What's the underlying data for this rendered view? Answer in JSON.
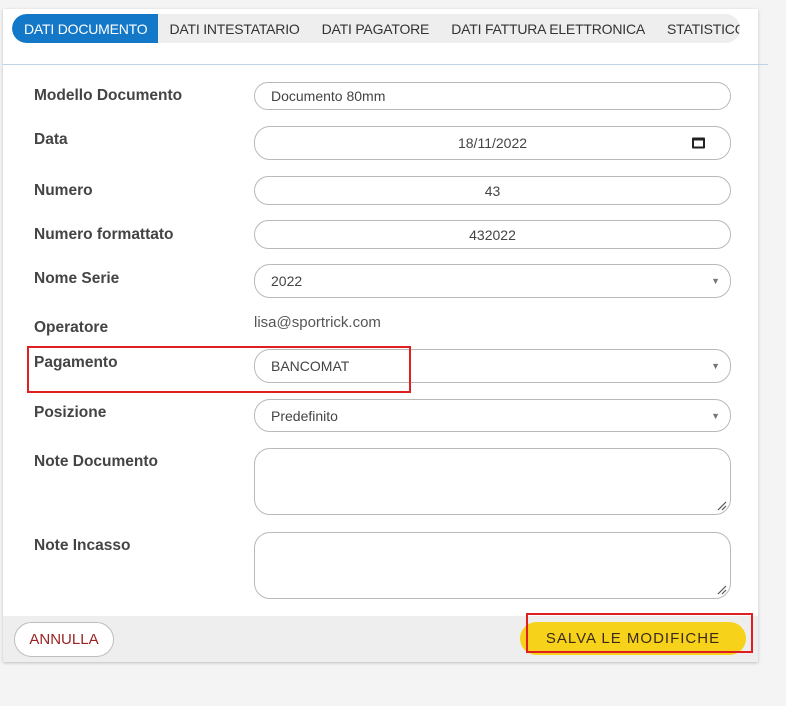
{
  "tabs": [
    {
      "label": "DATI DOCUMENTO",
      "active": true
    },
    {
      "label": "DATI INTESTATARIO",
      "active": false
    },
    {
      "label": "DATI PAGATORE",
      "active": false
    },
    {
      "label": "DATI FATTURA ELETTRONICA",
      "active": false
    },
    {
      "label": "STATISTICO",
      "active": false
    }
  ],
  "form": {
    "modello": {
      "label": "Modello Documento",
      "value": "Documento 80mm"
    },
    "data": {
      "label": "Data",
      "value": "18/11/2022",
      "icon": "calendar-icon"
    },
    "numero": {
      "label": "Numero",
      "value": "43"
    },
    "numero_formattato": {
      "label": "Numero formattato",
      "value": "432022"
    },
    "nome_serie": {
      "label": "Nome Serie",
      "value": "2022"
    },
    "operatore": {
      "label": "Operatore",
      "value": "lisa@sportrick.com"
    },
    "pagamento": {
      "label": "Pagamento",
      "value": "BANCOMAT"
    },
    "posizione": {
      "label": "Posizione",
      "value": "Predefinito"
    },
    "note_documento": {
      "label": "Note Documento",
      "value": ""
    },
    "note_incasso": {
      "label": "Note Incasso",
      "value": ""
    }
  },
  "footer": {
    "cancel_label": "ANNULLA",
    "save_label": "SALVA LE MODIFICHE"
  },
  "colors": {
    "tab_active_bg": "#1478c9",
    "save_button_bg": "#f7d21a",
    "cancel_text": "#9b2222",
    "highlight_border": "#e02020"
  }
}
